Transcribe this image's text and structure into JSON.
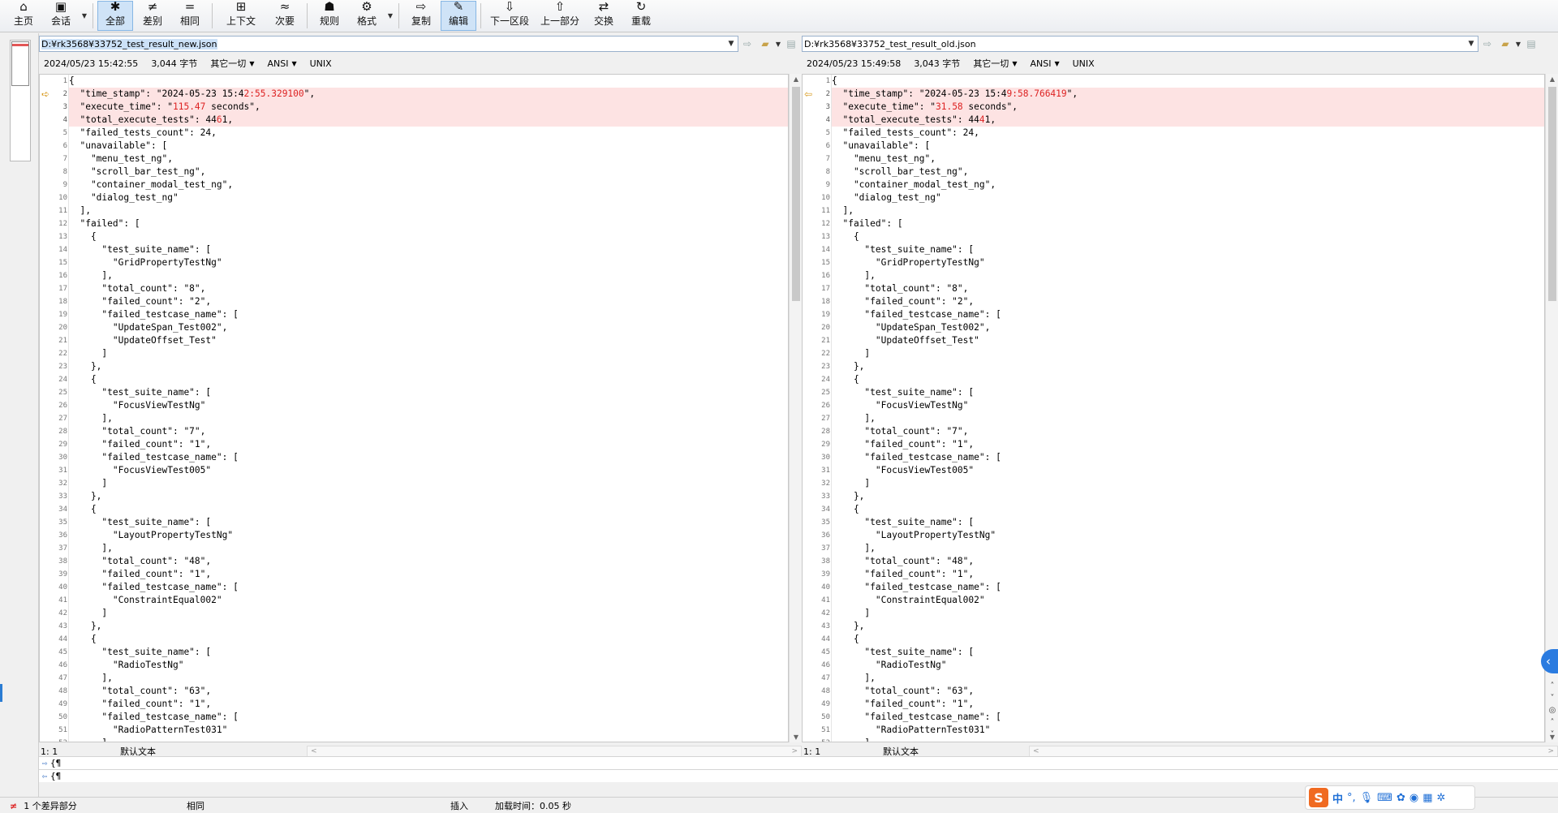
{
  "toolbar": {
    "buttons": [
      {
        "label": "主页",
        "icon": "home-icon",
        "glyph": "⌂"
      },
      {
        "label": "会话",
        "icon": "session-icon",
        "glyph": "▣"
      },
      {
        "label": "全部",
        "icon": "all-icon",
        "glyph": "✱"
      },
      {
        "label": "差别",
        "icon": "diff-icon",
        "glyph": "≠"
      },
      {
        "label": "相同",
        "icon": "same-icon",
        "glyph": "="
      },
      {
        "label": "上下文",
        "icon": "context-icon",
        "glyph": "⊞"
      },
      {
        "label": "次要",
        "icon": "minor-icon",
        "glyph": "≈"
      },
      {
        "label": "规则",
        "icon": "rules-icon",
        "glyph": "☗"
      },
      {
        "label": "格式",
        "icon": "format-icon",
        "glyph": "⚙"
      },
      {
        "label": "复制",
        "icon": "copy-icon",
        "glyph": "⇨"
      },
      {
        "label": "编辑",
        "icon": "edit-icon",
        "glyph": "✎"
      },
      {
        "label": "下一区段",
        "icon": "next-section-icon",
        "glyph": "⇩"
      },
      {
        "label": "上一部分",
        "icon": "prev-section-icon",
        "glyph": "⇧"
      },
      {
        "label": "交换",
        "icon": "swap-icon",
        "glyph": "⇄"
      },
      {
        "label": "重载",
        "icon": "reload-icon",
        "glyph": "↻"
      }
    ]
  },
  "left": {
    "path": "D:¥rk3568¥33752_test_result_new.json",
    "timestamp": "2024/05/23 15:42:55",
    "size": "3,044 字节",
    "linebreak": "其它一切",
    "encoding": "ANSI",
    "format": "UNIX",
    "cursor": "1: 1",
    "mode": "默认文本",
    "diff_lines": {
      "2": [
        "  \"time_stamp\": \"2024-05-23 15:4",
        "2:55.329100",
        "\","
      ],
      "3": [
        "  \"execute_time\": \"",
        "115.47",
        " seconds\","
      ],
      "4": [
        "  \"total_execute_tests\": 44",
        "6",
        "1,"
      ]
    }
  },
  "right": {
    "path": "D:¥rk3568¥33752_test_result_old.json",
    "timestamp": "2024/05/23 15:49:58",
    "size": "3,043 字节",
    "linebreak": "其它一切",
    "encoding": "ANSI",
    "format": "UNIX",
    "cursor": "1: 1",
    "mode": "默认文本",
    "diff_lines": {
      "2": [
        "  \"time_stamp\": \"2024-05-23 15:4",
        "9:58.766419",
        "\","
      ],
      "3": [
        "  \"execute_time\": \"",
        "31.58",
        " seconds\","
      ],
      "4": [
        "  \"total_execute_tests\": 44",
        "4",
        "1,"
      ]
    }
  },
  "common_lines": [
    "{",
    null,
    null,
    null,
    "  \"failed_tests_count\": 24,",
    "  \"unavailable\": [",
    "    \"menu_test_ng\",",
    "    \"scroll_bar_test_ng\",",
    "    \"container_modal_test_ng\",",
    "    \"dialog_test_ng\"",
    "  ],",
    "  \"failed\": [",
    "    {",
    "      \"test_suite_name\": [",
    "        \"GridPropertyTestNg\"",
    "      ],",
    "      \"total_count\": \"8\",",
    "      \"failed_count\": \"2\",",
    "      \"failed_testcase_name\": [",
    "        \"UpdateSpan_Test002\",",
    "        \"UpdateOffset_Test\"",
    "      ]",
    "    },",
    "    {",
    "      \"test_suite_name\": [",
    "        \"FocusViewTestNg\"",
    "      ],",
    "      \"total_count\": \"7\",",
    "      \"failed_count\": \"1\",",
    "      \"failed_testcase_name\": [",
    "        \"FocusViewTest005\"",
    "      ]",
    "    },",
    "    {",
    "      \"test_suite_name\": [",
    "        \"LayoutPropertyTestNg\"",
    "      ],",
    "      \"total_count\": \"48\",",
    "      \"failed_count\": \"1\",",
    "      \"failed_testcase_name\": [",
    "        \"ConstraintEqual002\"",
    "      ]",
    "    },",
    "    {",
    "      \"test_suite_name\": [",
    "        \"RadioTestNg\"",
    "      ],",
    "      \"total_count\": \"63\",",
    "      \"failed_count\": \"1\",",
    "      \"failed_testcase_name\": [",
    "        \"RadioPatternTest031\"",
    "      ]"
  ],
  "compare": {
    "row1": "{¶",
    "row2": "{¶"
  },
  "statusbar": {
    "diff_count": "1 个差异部分",
    "same": "相同",
    "insert": "插入",
    "load_time": "加载时间：0.05 秒"
  },
  "ime": {
    "logo": "S",
    "lang": "中",
    "punct": "°,",
    "icons": [
      "mic-icon",
      "keyboard-icon",
      "skin-icon",
      "game-icon",
      "apps-icon",
      "settings-icon"
    ]
  },
  "colors": {
    "diff_bg": "#fde3e3",
    "diff_text": "#d22222",
    "accent": "#2a7be0"
  }
}
